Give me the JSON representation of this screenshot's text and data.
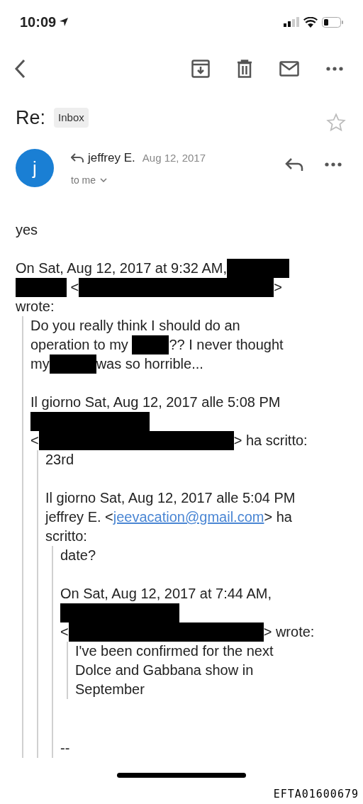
{
  "status_bar": {
    "time": "10:09"
  },
  "subject": {
    "title": "Re:",
    "label": "Inbox",
    "starred": false
  },
  "message": {
    "sender": "jeffrey E.",
    "avatar_letter": "j",
    "date": "Aug 12, 2017",
    "recipient": "to me"
  },
  "body": [
    {
      "kind": "text",
      "lines": [
        [
          {
            "kind": "text",
            "text": "yes"
          }
        ]
      ]
    },
    {
      "kind": "text",
      "lines": [
        [
          {
            "kind": "text",
            "text": "On Sat, Aug 12, 2017 at 9:32 AM,"
          },
          {
            "kind": "redaction"
          }
        ],
        [
          {
            "kind": "redaction"
          },
          {
            "kind": "text",
            "text": " <"
          },
          {
            "kind": "redaction"
          },
          {
            "kind": "text",
            "text": ">"
          }
        ],
        [
          {
            "kind": "text",
            "text": "wrote:"
          }
        ]
      ]
    },
    {
      "kind": "quote",
      "children": [
        {
          "kind": "text",
          "lines": [
            [
              {
                "kind": "text",
                "text": "Do you really think I should do an"
              }
            ],
            [
              {
                "kind": "text",
                "text": "operation to my "
              },
              {
                "kind": "redaction"
              },
              {
                "kind": "text",
                "text": "?? I never thought"
              }
            ],
            [
              {
                "kind": "text",
                "text": "my"
              },
              {
                "kind": "redaction"
              },
              {
                "kind": "text",
                "text": "was so horrible..."
              }
            ]
          ]
        },
        {
          "kind": "text",
          "lines": [
            [
              {
                "kind": "text",
                "text": "Il giorno Sat, Aug 12, 2017 alle 5:08 PM"
              }
            ],
            [
              {
                "kind": "redaction"
              }
            ],
            [
              {
                "kind": "text",
                "text": "<"
              },
              {
                "kind": "redaction"
              },
              {
                "kind": "text",
                "text": "> ha scritto:"
              }
            ]
          ]
        },
        {
          "kind": "quote",
          "children": [
            {
              "kind": "text",
              "lines": [
                [
                  {
                    "kind": "text",
                    "text": "23rd"
                  }
                ]
              ]
            },
            {
              "kind": "text",
              "lines": [
                [
                  {
                    "kind": "text",
                    "text": "Il giorno Sat, Aug 12, 2017 alle 5:04 PM"
                  }
                ],
                [
                  {
                    "kind": "text",
                    "text": "jeffrey E. <"
                  },
                  {
                    "kind": "link",
                    "text": "jeevacation@gmail.com"
                  },
                  {
                    "kind": "text",
                    "text": "> ha"
                  }
                ],
                [
                  {
                    "kind": "text",
                    "text": "scritto:"
                  }
                ]
              ]
            },
            {
              "kind": "quote",
              "children": [
                {
                  "kind": "text",
                  "lines": [
                    [
                      {
                        "kind": "text",
                        "text": "date?"
                      }
                    ]
                  ]
                },
                {
                  "kind": "text",
                  "lines": [
                    [
                      {
                        "kind": "text",
                        "text": "On Sat, Aug 12, 2017 at 7:44 AM,"
                      }
                    ],
                    [
                      {
                        "kind": "redaction"
                      }
                    ],
                    [
                      {
                        "kind": "text",
                        "text": "<"
                      },
                      {
                        "kind": "redaction"
                      },
                      {
                        "kind": "text",
                        "text": "> wrote:"
                      }
                    ]
                  ]
                },
                {
                  "kind": "quote",
                  "children": [
                    {
                      "kind": "text",
                      "lines": [
                        [
                          {
                            "kind": "text",
                            "text": "I've been confirmed for the next"
                          }
                        ],
                        [
                          {
                            "kind": "text",
                            "text": "Dolce and Gabbana show in"
                          }
                        ],
                        [
                          {
                            "kind": "text",
                            "text": "September"
                          }
                        ]
                      ]
                    }
                  ]
                },
                {
                  "kind": "signature",
                  "lines": [
                    [
                      {
                        "kind": "text",
                        "text": "--"
                      }
                    ]
                  ]
                }
              ]
            }
          ]
        }
      ]
    }
  ],
  "document_stamp": "EFTA01600679"
}
